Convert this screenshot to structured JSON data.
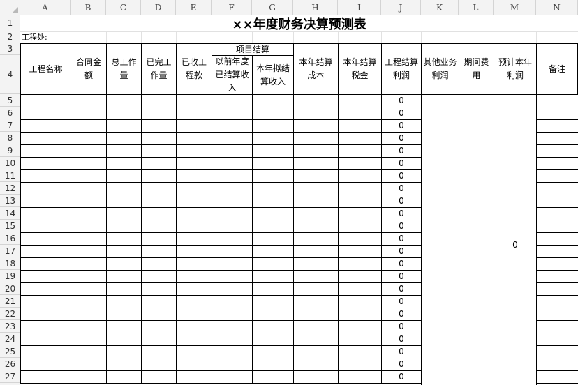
{
  "columns": [
    "A",
    "B",
    "C",
    "D",
    "E",
    "F",
    "G",
    "H",
    "I",
    "J",
    "K",
    "L",
    "M",
    "N"
  ],
  "rows": [
    "1",
    "2",
    "3",
    "4",
    "5",
    "6",
    "7",
    "8",
    "9",
    "10",
    "11",
    "12",
    "13",
    "14",
    "15",
    "16",
    "17",
    "18",
    "19",
    "20",
    "21",
    "22",
    "23",
    "24",
    "25",
    "26",
    "27"
  ],
  "title": "××年度财务决算预测表",
  "subtitle": "工程处:",
  "headers": {
    "project_name": "工程名称",
    "contract_amount": "合同金额",
    "total_workload": "总工作量",
    "completed_workload": "已完工作量",
    "received_payment": "已收工程款",
    "project_settlement": "项目结算",
    "prior_settled_income": "以前年度已结算收入",
    "planned_income": "本年拟结算收入",
    "settlement_cost": "本年结算成本",
    "settlement_tax": "本年结算税金",
    "settlement_profit": "工程结算利润",
    "other_profit": "其他业务利润",
    "period_expense": "期间费用",
    "estimated_profit": "预计本年利润",
    "remarks": "备注"
  },
  "settlement_profit_values": [
    "0",
    "0",
    "0",
    "0",
    "0",
    "0",
    "0",
    "0",
    "0",
    "0",
    "0",
    "0",
    "0",
    "0",
    "0",
    "0",
    "0",
    "0",
    "0",
    "0",
    "0",
    "0",
    "0"
  ],
  "estimated_profit_value": "0"
}
